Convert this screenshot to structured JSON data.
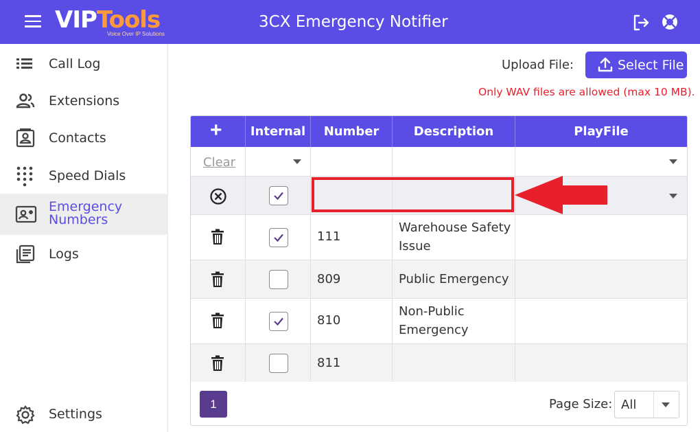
{
  "header": {
    "logo_main_a": "V",
    "logo_main_b": "IP",
    "logo_main_c": "Tools",
    "logo_sub": "Voice Over IP Solutions",
    "title": "3CX Emergency Notifier"
  },
  "sidebar": {
    "items": [
      {
        "label": "Call Log",
        "icon": "list-icon"
      },
      {
        "label": "Extensions",
        "icon": "users-icon"
      },
      {
        "label": "Contacts",
        "icon": "contact-card-icon"
      },
      {
        "label": "Speed Dials",
        "icon": "dialpad-icon"
      },
      {
        "label": "Emergency Numbers",
        "icon": "emergency-card-icon",
        "active": true
      },
      {
        "label": "Logs",
        "icon": "document-icon"
      }
    ],
    "settings_label": "Settings"
  },
  "upload": {
    "label": "Upload File:",
    "button_label": "Select File",
    "warning": "Only WAV files are allowed (max 10 MB)."
  },
  "grid": {
    "columns": [
      "Internal",
      "Number",
      "Description",
      "PlayFile"
    ],
    "add_symbol": "+",
    "filter_clear": "Clear",
    "rows": [
      {
        "internal": true,
        "number": "111",
        "description_1": "Warehouse Safety",
        "description_2": "Issue",
        "playfile": ""
      },
      {
        "internal": false,
        "number": "809",
        "description_1": "Public Emergency",
        "description_2": "",
        "playfile": ""
      },
      {
        "internal": true,
        "number": "810",
        "description_1": "Non-Public",
        "description_2": "Emergency",
        "playfile": ""
      },
      {
        "internal": false,
        "number": "811",
        "description_1": "",
        "description_2": "",
        "playfile": ""
      }
    ]
  },
  "pager": {
    "current_page": "1",
    "page_size_label": "Page Size:",
    "page_size_value": "All"
  },
  "colors": {
    "primary": "#5a4de6",
    "warning": "#e8202c",
    "page_button": "#5a3c8f"
  }
}
